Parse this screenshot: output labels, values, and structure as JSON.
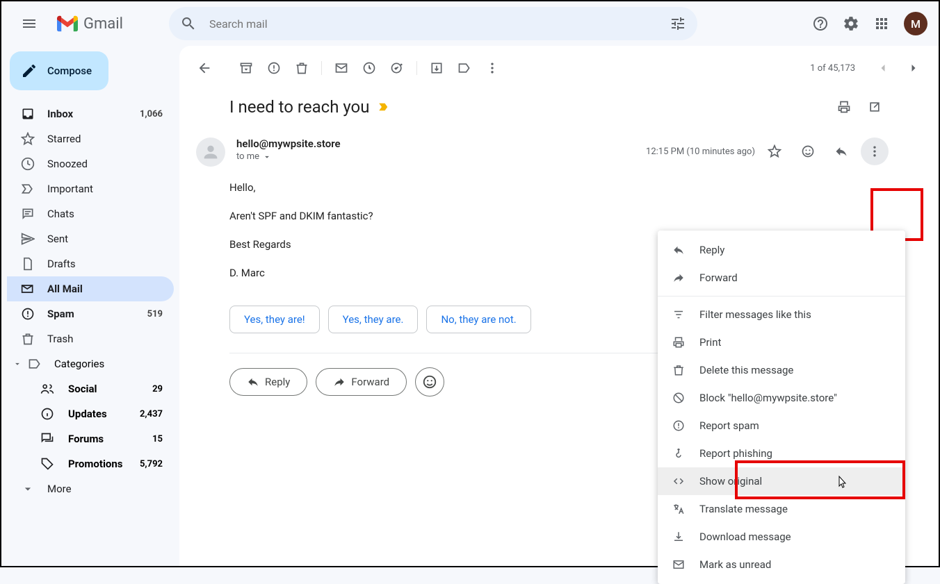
{
  "header": {
    "logo_text": "Gmail",
    "search_placeholder": "Search mail",
    "avatar_letter": "M"
  },
  "compose": {
    "label": "Compose"
  },
  "sidebar": {
    "inbox": {
      "label": "Inbox",
      "count": "1,066"
    },
    "starred": {
      "label": "Starred"
    },
    "snoozed": {
      "label": "Snoozed"
    },
    "important": {
      "label": "Important"
    },
    "chats": {
      "label": "Chats"
    },
    "sent": {
      "label": "Sent"
    },
    "drafts": {
      "label": "Drafts"
    },
    "allmail": {
      "label": "All Mail"
    },
    "spam": {
      "label": "Spam",
      "count": "519"
    },
    "trash": {
      "label": "Trash"
    },
    "categories": {
      "label": "Categories"
    },
    "social": {
      "label": "Social",
      "count": "29"
    },
    "updates": {
      "label": "Updates",
      "count": "2,437"
    },
    "forums": {
      "label": "Forums",
      "count": "15"
    },
    "promotions": {
      "label": "Promotions",
      "count": "5,792"
    },
    "more": {
      "label": "More"
    }
  },
  "toolbar": {
    "count_text": "1 of 45,173"
  },
  "email": {
    "subject": "I need to reach you",
    "sender": "hello@mywpsite.store",
    "to_text": "to me",
    "time": "12:15 PM (10 minutes ago)",
    "body": {
      "l1": "Hello,",
      "l2": "Aren't SPF and DKIM fantastic?",
      "l3": "Best Regards",
      "l4": "D. Marc"
    },
    "smart": {
      "r1": "Yes, they are!",
      "r2": "Yes, they are.",
      "r3": "No, they are not."
    },
    "reply_label": "Reply",
    "forward_label": "Forward"
  },
  "menu": {
    "reply": "Reply",
    "forward": "Forward",
    "filter": "Filter messages like this",
    "print": "Print",
    "delete": "Delete this message",
    "block": "Block \"hello@mywpsite.store\"",
    "spam": "Report spam",
    "phishing": "Report phishing",
    "show_original": "Show original",
    "translate": "Translate message",
    "download": "Download message",
    "unread": "Mark as unread"
  }
}
